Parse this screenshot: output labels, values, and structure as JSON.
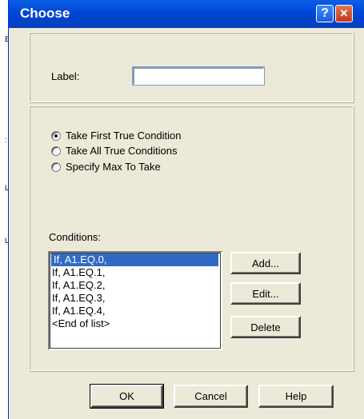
{
  "edge": {
    "marks": [
      "E",
      ":",
      "L",
      "L"
    ]
  },
  "window": {
    "title": "Choose",
    "help_glyph": "?",
    "close_glyph": "✕"
  },
  "label_group": {
    "label": "Label:",
    "value": ""
  },
  "take_options": [
    {
      "label": "Take First True Condition",
      "selected": true
    },
    {
      "label": "Take All True Conditions",
      "selected": false
    },
    {
      "label": "Specify Max To Take",
      "selected": false
    }
  ],
  "conditions": {
    "label": "Conditions:",
    "items": [
      "If, A1.EQ.0,",
      "If, A1.EQ.1,",
      "If, A1.EQ.2,",
      "If, A1.EQ.3,",
      "If, A1.EQ.4,",
      "<End of list>"
    ],
    "selected_index": 0
  },
  "side_buttons": {
    "add": "Add...",
    "edit": "Edit...",
    "delete": "Delete"
  },
  "footer": {
    "ok": "OK",
    "cancel": "Cancel",
    "help": "Help"
  }
}
